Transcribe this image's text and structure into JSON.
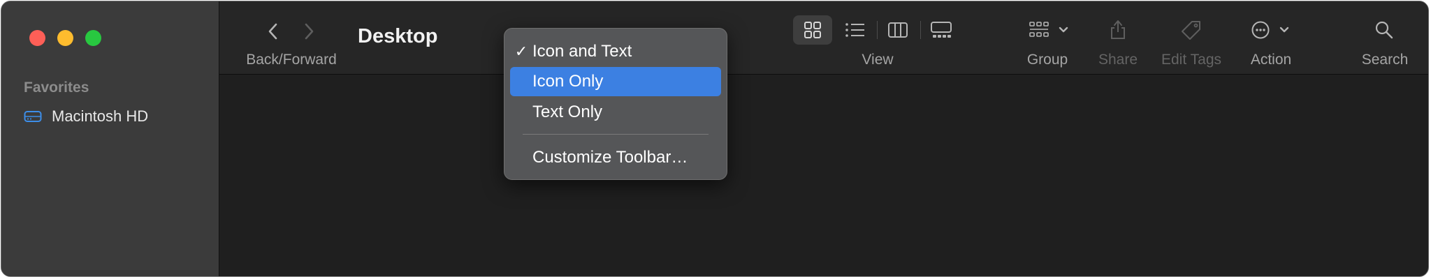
{
  "window": {
    "title": "Desktop"
  },
  "sidebar": {
    "section_header": "Favorites",
    "items": [
      {
        "label": "Macintosh HD",
        "icon": "internal-drive-icon"
      }
    ]
  },
  "toolbar": {
    "back_forward_label": "Back/Forward",
    "view_label": "View",
    "group_label": "Group",
    "share_label": "Share",
    "edit_tags_label": "Edit Tags",
    "action_label": "Action",
    "search_label": "Search",
    "view_modes": [
      "icon-view-icon",
      "list-view-icon",
      "column-view-icon",
      "gallery-view-icon"
    ],
    "selected_view_mode": "icon-view-icon"
  },
  "context_menu": {
    "items": [
      {
        "label": "Icon and Text",
        "checked": true,
        "highlighted": false
      },
      {
        "label": "Icon Only",
        "checked": false,
        "highlighted": true
      },
      {
        "label": "Text Only",
        "checked": false,
        "highlighted": false
      }
    ],
    "customize_label": "Customize Toolbar…"
  },
  "colors": {
    "menu_highlight": "#3c80e2",
    "close": "#fe5f57",
    "minimize": "#febc2e",
    "maximize": "#28c840",
    "drive_icon": "#3d8ee8"
  }
}
